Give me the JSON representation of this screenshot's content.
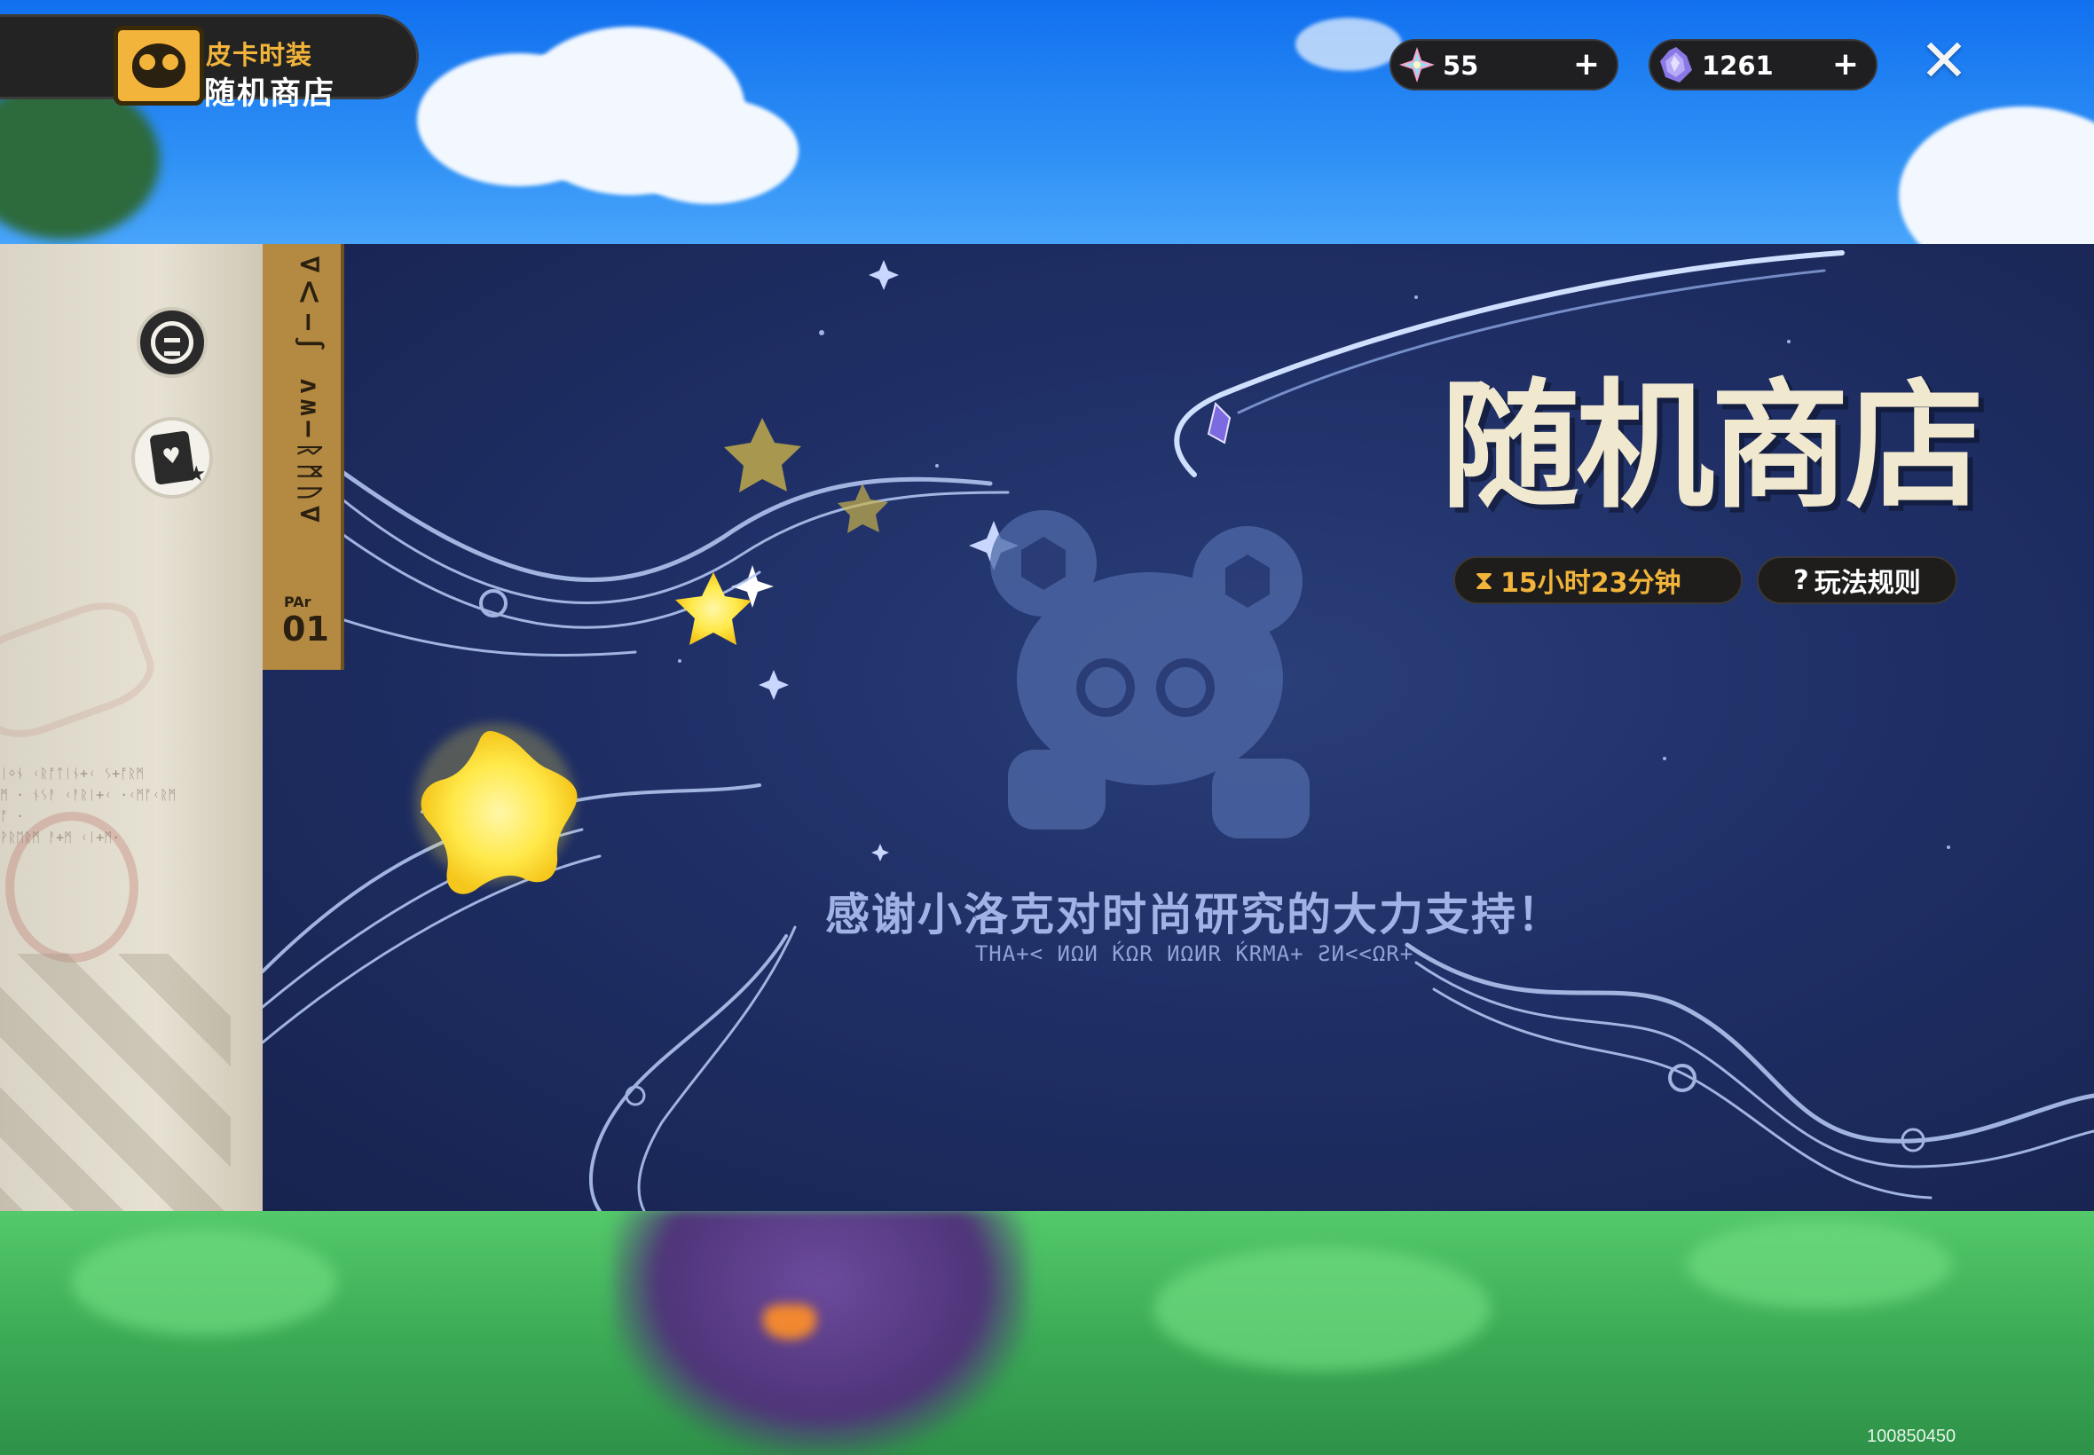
{
  "header": {
    "title_sub": "皮卡时装",
    "title_main": "随机商店",
    "icon": "mascot-book-icon"
  },
  "currencies": [
    {
      "icon": "rainbow-crystal-icon",
      "value": "55",
      "plus": "+"
    },
    {
      "icon": "purple-crystal-icon",
      "value": "1261",
      "plus": "+"
    }
  ],
  "close": {
    "label": "✕",
    "icon": "close-icon"
  },
  "sidebar": {
    "buttons": [
      {
        "icon": "random-shop-icon"
      },
      {
        "icon": "card-icon"
      }
    ]
  },
  "banner": {
    "tab_text": "∇ᐱ–∫ ʌʍ–ᚱᛗᚢ∇",
    "tab_par": "PAr",
    "tab_num": "01",
    "heading": "随机商店",
    "timer": "15小时23分钟",
    "rules": "玩法规则",
    "thanks": "感谢小洛克对时尚研究的大力支持！",
    "thanks_rune": "THA+< ИΩИ ЌΩR ИΩИR ЌRMA+ ƧИ<<ΩR+"
  },
  "build_id": "100850450",
  "colors": {
    "accent": "#f2b43a",
    "banner_bg": "#1f2f66",
    "heading": "#f1e8d0"
  }
}
